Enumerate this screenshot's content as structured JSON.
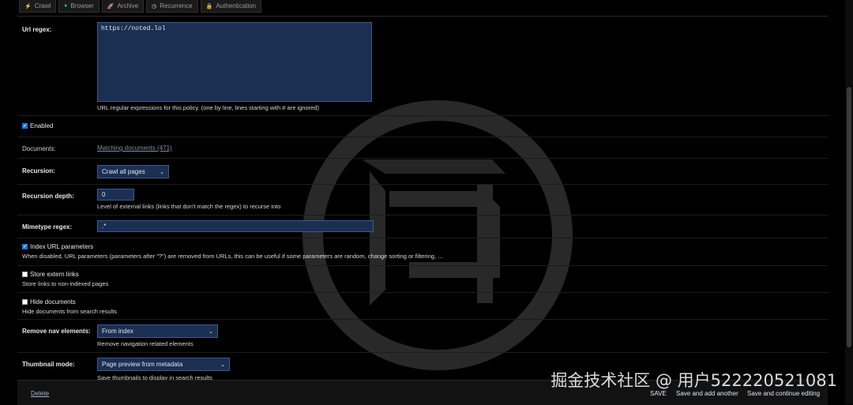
{
  "tabs": [
    {
      "label": "Crawl",
      "icon": "lightning-icon"
    },
    {
      "label": "Browser",
      "icon": "globe-icon"
    },
    {
      "label": "Archive",
      "icon": "rocket-icon"
    },
    {
      "label": "Recurrence",
      "icon": "clock-icon"
    },
    {
      "label": "Authentication",
      "icon": "lock-icon"
    }
  ],
  "form": {
    "url_regex": {
      "label": "Url regex:",
      "value": "https://noted.lol",
      "help": "URL regular expressions for this policy. (one by line, lines starting with # are ignored)"
    },
    "enabled": {
      "label": "Enabled",
      "checked": true
    },
    "documents": {
      "label": "Documents:",
      "link": "Matching documents (471)"
    },
    "recursion": {
      "label": "Recursion:",
      "value": "Crawl all pages"
    },
    "recursion_depth": {
      "label": "Recursion depth:",
      "value": "0",
      "help": "Level of external links (links that don't match the regex) to recurse into"
    },
    "mimetype_regex": {
      "label": "Mimetype regex:",
      "value": ".*"
    },
    "index_url_params": {
      "label": "Index URL parameters",
      "checked": true,
      "help": "When disabled, URL parameters (parameters after \"?\") are removed from URLs, this can be useful if some parameters are random, change sorting or filtering, ..."
    },
    "store_extern_links": {
      "label": "Store extern links",
      "checked": false,
      "help": "Store links to non-indexed pages"
    },
    "hide_documents": {
      "label": "Hide documents",
      "checked": false,
      "help": "Hide documents from search results"
    },
    "remove_nav": {
      "label": "Remove nav elements:",
      "value": "From index",
      "help": "Remove navigation related elements"
    },
    "thumbnail_mode": {
      "label": "Thumbnail mode:",
      "value": "Page preview from metadata",
      "help": "Save thumbnails to display in search results"
    }
  },
  "footer": {
    "delete": "Delete",
    "save": "SAVE",
    "save_add": "Save and add another",
    "save_continue": "Save and continue editing"
  },
  "watermark": "掘金技术社区 @ 用户522220521081",
  "colors": {
    "background": "#000000",
    "field_bg": "#1b2f52",
    "field_border": "#3a5a8a",
    "checkbox_on": "#1a73e8"
  }
}
